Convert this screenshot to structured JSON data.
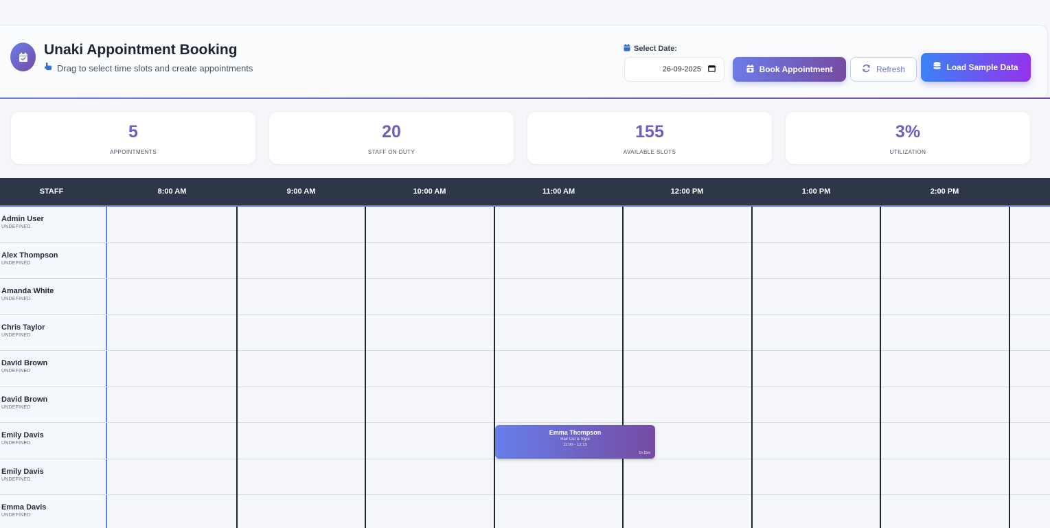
{
  "header": {
    "title": "Unaki Appointment Booking",
    "subtitle": "Drag to select time slots and create appointments",
    "date_label": "Select Date:",
    "date_value": "26-09-2025",
    "book_label": "Book Appointment",
    "refresh_label": "Refresh",
    "sample_label": "Load Sample Data"
  },
  "stats": [
    {
      "value": "5",
      "label": "APPOINTMENTS"
    },
    {
      "value": "20",
      "label": "STAFF ON DUTY"
    },
    {
      "value": "155",
      "label": "AVAILABLE SLOTS"
    },
    {
      "value": "3%",
      "label": "UTILIZATION"
    }
  ],
  "grid": {
    "staff_header": "STAFF",
    "times": [
      "8:00 AM",
      "9:00 AM",
      "10:00 AM",
      "11:00 AM",
      "12:00 PM",
      "1:00 PM",
      "2:00 PM"
    ],
    "staff": [
      {
        "name": "Admin User",
        "role": "UNDEFINED"
      },
      {
        "name": "Alex Thompson",
        "role": "UNDEFINED"
      },
      {
        "name": "Amanda White",
        "role": "UNDEFINED"
      },
      {
        "name": "Chris Taylor",
        "role": "UNDEFINED"
      },
      {
        "name": "David Brown",
        "role": "UNDEFINED"
      },
      {
        "name": "David Brown",
        "role": "UNDEFINED"
      },
      {
        "name": "Emily Davis",
        "role": "UNDEFINED"
      },
      {
        "name": "Emily Davis",
        "role": "UNDEFINED"
      },
      {
        "name": "Emma Davis",
        "role": "UNDEFINED"
      }
    ]
  },
  "appointment": {
    "client": "Emma Thompson",
    "service": "Hair Cut & Style",
    "time": "11:00 - 12:15",
    "duration": "1h 15m"
  },
  "colors": {
    "accent_start": "#667eea",
    "accent_end": "#764ba2",
    "grid_header": "#2d3748",
    "stat_value": "#6a60c0"
  }
}
